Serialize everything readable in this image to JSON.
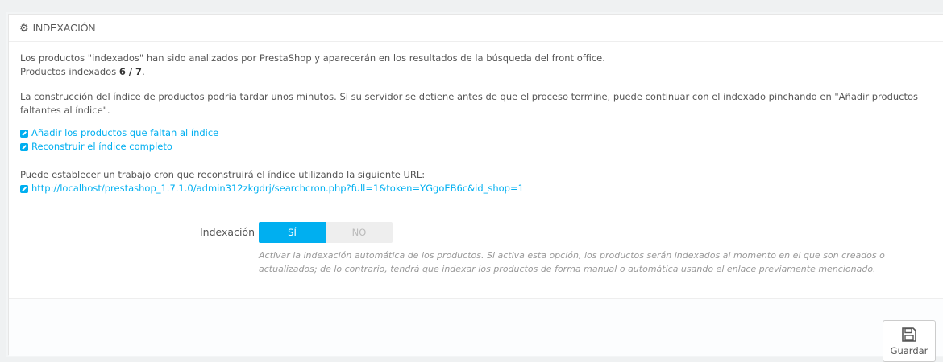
{
  "panel": {
    "title": "INDEXACIÓN",
    "heading_icon": "cogs-icon"
  },
  "intro": {
    "line1": "Los productos \"indexados\" han sido analizados por PrestaShop y aparecerán en los resultados de la búsqueda del front office.",
    "indexed_prefix": "Productos indexados",
    "indexed_count": "6 / 7",
    "indexed_suffix": "."
  },
  "build_notice": "La construcción del índice de productos podría tardar unos minutos. Si su servidor se detiene antes de que el proceso termine, puede continuar con el indexado pinchando en \"Añadir productos faltantes al índice\".",
  "links": {
    "add_missing": "Añadir los productos que faltan al índice",
    "rebuild": "Reconstruir el índice completo",
    "icon": "external-link-icon"
  },
  "cron": {
    "intro": "Puede establecer un trabajo cron que reconstruirá el índice utilizando la siguiente URL:",
    "url": "http://localhost/prestashop_1.7.1.0/admin312zkgdrj/searchcron.php?full=1&token=YGgoEB6c&id_shop=1"
  },
  "setting": {
    "label": "Indexación",
    "yes": "SÍ",
    "no": "NO",
    "selected": "yes",
    "help": "Activar la indexación automática de los productos. Si activa esta opción, los productos serán indexados al momento en el que son creados o actualizados; de lo contrario, tendrá que indexar los productos de forma manual o automática usando el enlace previamente mencionado."
  },
  "footer": {
    "save_label": "Guardar",
    "save_icon": "floppy-disk-icon"
  },
  "colors": {
    "accent": "#00aff0",
    "text": "#555555",
    "help_text": "#999999"
  }
}
